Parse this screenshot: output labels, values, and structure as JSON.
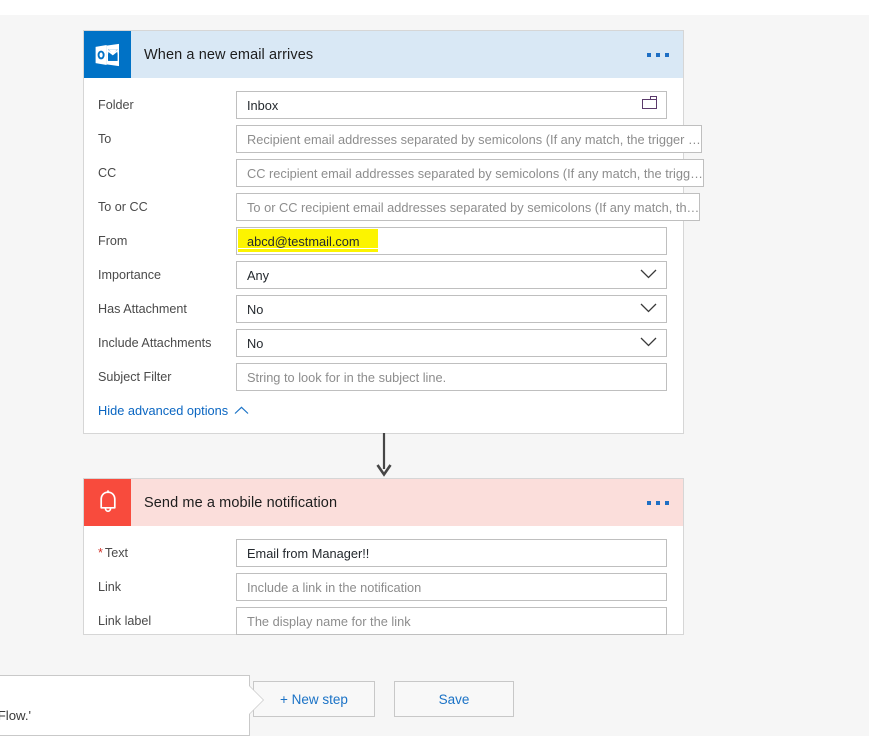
{
  "cards": [
    {
      "id": "trigger",
      "title": "When a new email arrives",
      "icon": "outlook-icon",
      "header_color": "#d9e8f5",
      "icon_color": "#0072c6",
      "menu": "more-options",
      "fields": [
        {
          "label": "Folder",
          "value": "Inbox",
          "placeholder": "",
          "control": "text-with-folder-picker",
          "required": false
        },
        {
          "label": "To",
          "value": "",
          "placeholder": "Recipient email addresses separated by semicolons (If any match, the trigger …",
          "control": "text",
          "required": false
        },
        {
          "label": "CC",
          "value": "",
          "placeholder": "CC recipient email addresses separated by semicolons (If any match, the trigg…",
          "control": "text",
          "required": false
        },
        {
          "label": "To or CC",
          "value": "",
          "placeholder": "To or CC recipient email addresses separated by semicolons (If any match, th…",
          "control": "text",
          "required": false
        },
        {
          "label": "From",
          "value": "abcd@testmail.com",
          "placeholder": "",
          "control": "text",
          "required": false,
          "highlighted": true
        },
        {
          "label": "Importance",
          "value": "Any",
          "placeholder": "",
          "control": "dropdown",
          "required": false
        },
        {
          "label": "Has Attachment",
          "value": "No",
          "placeholder": "",
          "control": "dropdown",
          "required": false
        },
        {
          "label": "Include Attachments",
          "value": "No",
          "placeholder": "",
          "control": "dropdown",
          "required": false
        },
        {
          "label": "Subject Filter",
          "value": "",
          "placeholder": "String to look for in the subject line.",
          "control": "text",
          "required": false
        }
      ],
      "advanced_link": "Hide advanced options"
    },
    {
      "id": "action",
      "title": "Send me a mobile notification",
      "icon": "bell-icon",
      "header_color": "#fbdedb",
      "icon_color": "#f84b3d",
      "menu": "more-options",
      "fields": [
        {
          "label": "Text",
          "value": "Email from Manager!!",
          "placeholder": "",
          "control": "text",
          "required": true
        },
        {
          "label": "Link",
          "value": "",
          "placeholder": "Include a link in the notification",
          "control": "text",
          "required": false
        },
        {
          "label": "Link label",
          "value": "",
          "placeholder": "The display name for the link",
          "control": "text",
          "required": false
        }
      ]
    }
  ],
  "connector": {
    "name": "flow-arrow"
  },
  "footer": {
    "new_step_label": "+ New step",
    "save_label": "Save"
  },
  "tooltip": {
    "text": "ow has a name and choose 'Create Flow.'"
  },
  "colors": {
    "accent_blue": "#0072c6",
    "link_blue": "#1a72c6",
    "alert_red": "#f84b3d",
    "highlight_yellow": "#fcf400",
    "page_bg": "#f6f6f6"
  }
}
